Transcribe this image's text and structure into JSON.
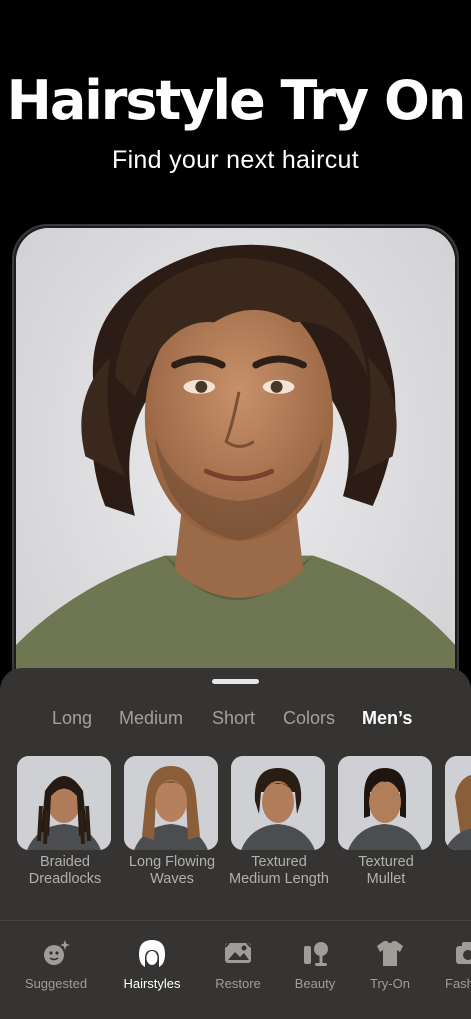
{
  "hero": {
    "title": "Hairstyle Try On",
    "subtitle": "Find your next haircut"
  },
  "categories": [
    {
      "label": "Long",
      "active": false
    },
    {
      "label": "Medium",
      "active": false
    },
    {
      "label": "Short",
      "active": false
    },
    {
      "label": "Colors",
      "active": false
    },
    {
      "label": "Men’s",
      "active": true
    }
  ],
  "styles": [
    {
      "label": "Braided\nDreadlocks"
    },
    {
      "label": "Long Flowing\nWaves"
    },
    {
      "label": "Textured\nMedium Length"
    },
    {
      "label": "Textured\nMullet"
    }
  ],
  "nav": [
    {
      "label": "Suggested",
      "icon": "sparkle-face-icon",
      "active": false
    },
    {
      "label": "Hairstyles",
      "icon": "hair-icon",
      "active": true
    },
    {
      "label": "Restore",
      "icon": "restore-photo-icon",
      "active": false
    },
    {
      "label": "Beauty",
      "icon": "beauty-mirror-icon",
      "active": false
    },
    {
      "label": "Try-On",
      "icon": "shirt-icon",
      "active": false
    },
    {
      "label": "Fash",
      "icon": "camera-icon",
      "active": false
    }
  ],
  "colors": {
    "sheet": "#353432",
    "active_text": "#ffffff",
    "inactive_text": "#a3a19d"
  }
}
